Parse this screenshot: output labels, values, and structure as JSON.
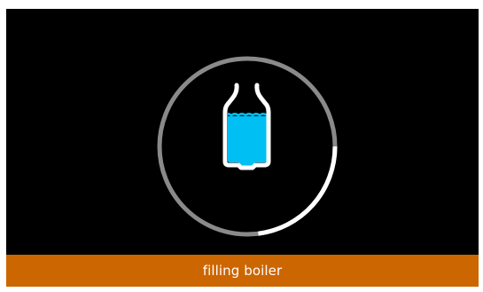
{
  "status": {
    "message": "filling boiler",
    "bar_color": "#cc6600"
  },
  "progress": {
    "fraction": 0.23,
    "track_color": "#8a8a8a",
    "fill_color": "#ffffff"
  },
  "icon": {
    "name": "boiler-icon",
    "water_level": 0.65,
    "water_color": "#00bff3",
    "outline_color": "#ffffff"
  }
}
